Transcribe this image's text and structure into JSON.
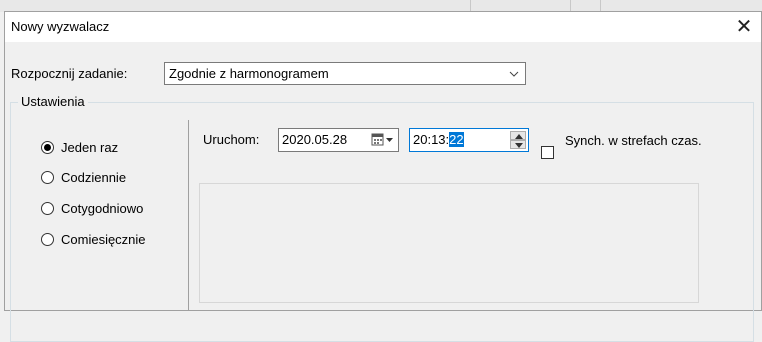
{
  "dialog": {
    "title": "Nowy wyzwalacz",
    "close_glyph": "✕"
  },
  "start_task": {
    "label": "Rozpocznij zadanie:",
    "value": "Zgodnie z harmonogramem"
  },
  "settings": {
    "legend": "Ustawienia",
    "frequency_options": [
      {
        "label": "Jeden raz",
        "checked": true
      },
      {
        "label": "Codziennie",
        "checked": false
      },
      {
        "label": "Cotygodniowo",
        "checked": false
      },
      {
        "label": "Comiesięcznie",
        "checked": false
      }
    ],
    "run": {
      "label": "Uruchom:",
      "date": "2020.05.28",
      "time_prefix": "20:13:",
      "time_selected": "22"
    },
    "sync_timezones": {
      "label": "Synch. w strefach czas.",
      "checked": false
    }
  },
  "colors": {
    "selection": "#0078d7",
    "dialog_bg": "#f0f0f0"
  },
  "icons": {
    "close": "close-icon",
    "dropdown": "chevron-down-icon",
    "calendar": "calendar-icon",
    "spin_up": "spin-up-icon",
    "spin_down": "spin-down-icon"
  }
}
